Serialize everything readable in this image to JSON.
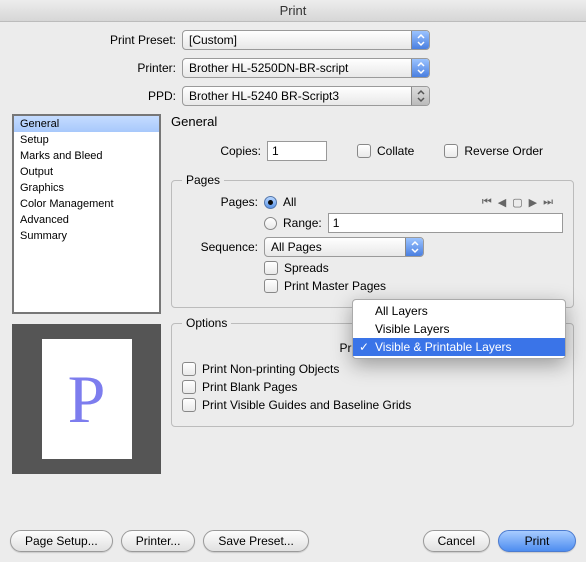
{
  "title": "Print",
  "top": {
    "preset_label": "Print Preset:",
    "preset_value": "[Custom]",
    "printer_label": "Printer:",
    "printer_value": "Brother HL-5250DN-BR-script",
    "ppd_label": "PPD:",
    "ppd_value": "Brother HL-5240 BR-Script3"
  },
  "panels": [
    "General",
    "Setup",
    "Marks and Bleed",
    "Output",
    "Graphics",
    "Color Management",
    "Advanced",
    "Summary"
  ],
  "panel_selected": 0,
  "general": {
    "heading": "General",
    "copies_label": "Copies:",
    "copies_value": "1",
    "collate_label": "Collate",
    "reverse_label": "Reverse Order",
    "pages_legend": "Pages",
    "pages_label": "Pages:",
    "all_label": "All",
    "range_label": "Range:",
    "range_value": "1",
    "sequence_label": "Sequence:",
    "sequence_value": "All Pages",
    "spreads_label": "Spreads",
    "master_label": "Print Master Pages",
    "options_legend": "Options",
    "printlayers_label": "Print Layers",
    "layers_menu": [
      "All Layers",
      "Visible Layers",
      "Visible & Printable Layers"
    ],
    "layers_selected": 2,
    "nonprinting_label": "Print Non-printing Objects",
    "blank_label": "Print Blank Pages",
    "guides_label": "Print Visible Guides and Baseline Grids"
  },
  "preview_letter": "P",
  "buttons": {
    "page_setup": "Page Setup...",
    "printer": "Printer...",
    "save_preset": "Save Preset...",
    "cancel": "Cancel",
    "print": "Print"
  }
}
